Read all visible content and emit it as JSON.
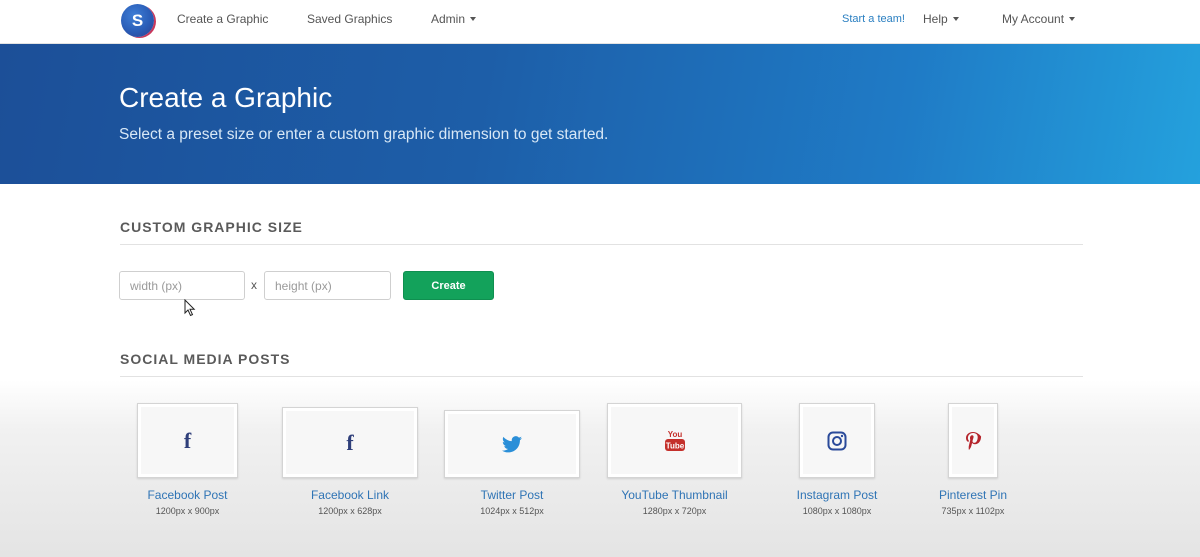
{
  "nav": {
    "logo_letter": "S",
    "create_graphic": "Create a Graphic",
    "saved_graphics": "Saved Graphics",
    "admin": "Admin",
    "start_team": "Start a team!",
    "help": "Help",
    "my_account": "My Account"
  },
  "hero": {
    "title": "Create a Graphic",
    "subtitle": "Select a preset size or enter a custom graphic dimension to get started."
  },
  "custom": {
    "section_title": "CUSTOM GRAPHIC SIZE",
    "width_placeholder": "width (px)",
    "height_placeholder": "height (px)",
    "times": "x",
    "create_label": "Create"
  },
  "social": {
    "section_title": "SOCIAL MEDIA POSTS",
    "items": [
      {
        "label": "Facebook Post",
        "size": "1200px x 900px",
        "icon": "facebook-icon"
      },
      {
        "label": "Facebook Link",
        "size": "1200px x 628px",
        "icon": "facebook-icon"
      },
      {
        "label": "Twitter Post",
        "size": "1024px x 512px",
        "icon": "twitter-icon"
      },
      {
        "label": "YouTube Thumbnail",
        "size": "1280px x 720px",
        "icon": "youtube-icon"
      },
      {
        "label": "Instagram Post",
        "size": "1080px x 1080px",
        "icon": "instagram-icon"
      },
      {
        "label": "Pinterest Pin",
        "size": "735px x 1102px",
        "icon": "pinterest-icon"
      }
    ]
  },
  "colors": {
    "accent_blue": "#2a7fc1",
    "create_green": "#13a25b",
    "facebook": "#2f3f7a",
    "twitter": "#2b8fd8",
    "youtube": "#c4302b",
    "instagram": "#2a4a9a",
    "pinterest": "#b5242b"
  }
}
